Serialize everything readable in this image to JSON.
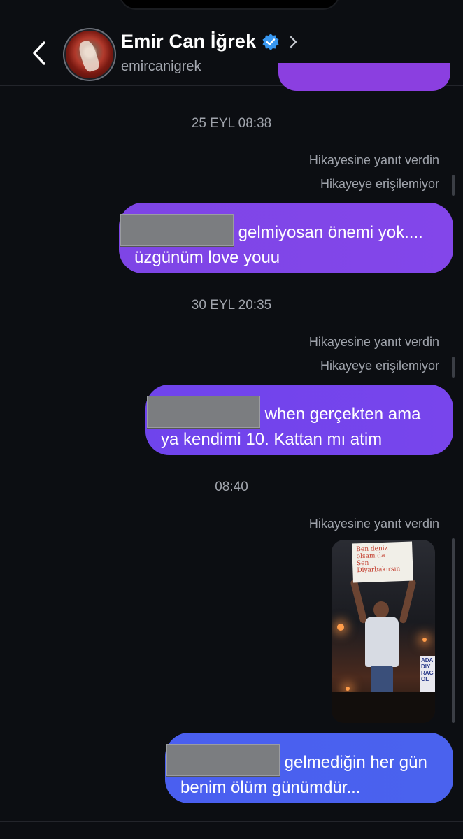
{
  "header": {
    "name": "Emir Can İğrek",
    "username": "emircanigrek"
  },
  "messages": {
    "stamp1": "25 EYL 08:38",
    "meta1a": "Hikayesine yanıt verdin",
    "meta1b": "Hikayeye erişilemiyor",
    "bubble1": "gelmiyosan önemi yok.... üzgünüm love youu",
    "stamp2": "30 EYL 20:35",
    "meta2a": "Hikayesine yanıt verdin",
    "meta2b": "Hikayeye erişilemiyor",
    "bubble2": "when gerçekten ama ya kendimi 10. Kattan mı atim",
    "stamp3": "08:40",
    "meta3a": "Hikayesine yanıt verdin",
    "story": {
      "sign_line1": "Ben deniz",
      "sign_line2": "olsam da",
      "sign_line3": "Sen Diyarbakırsın",
      "banner": "ADA DİY RAG OL"
    },
    "bubble3": "gelmediğin her gün benim ölüm günümdür..."
  },
  "colors": {
    "background": "#0c0e12",
    "bubble_purple": "#7a44ec",
    "bubble_blue": "#4a5ff0",
    "verified": "#3897f0"
  },
  "icons": {
    "back": "chevron-left-icon",
    "verified": "verified-badge-icon",
    "profile": "chevron-right-icon"
  }
}
